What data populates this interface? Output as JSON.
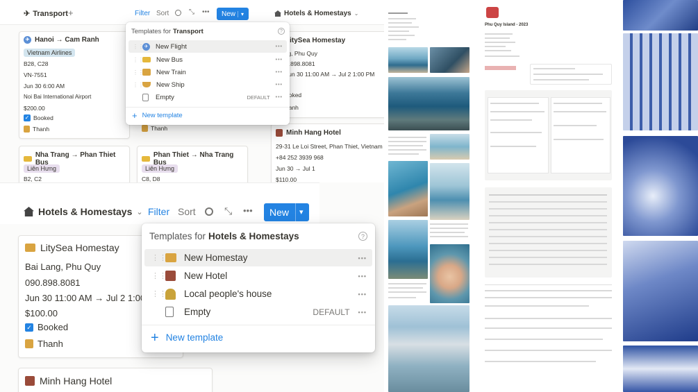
{
  "transport": {
    "tab": "Transport",
    "add": "+",
    "filter": "Filter",
    "sort": "Sort",
    "new": "New",
    "dropdown": "⌄",
    "cards": [
      {
        "title": "Hanoi → Cam Ranh",
        "airline": "Vietnam Airlines",
        "seats": "B28, C28",
        "code": "VN-7551",
        "time": "Jun 30 6:00 AM",
        "place": "Noi Bai International Airport",
        "price": "$200.00",
        "booked": "Booked",
        "person": "Thanh"
      },
      {
        "title": "Nha Trang → Phan Thiet Bus",
        "airline": "Liên Hưng",
        "seats": "B2, C2"
      },
      {
        "title": "Phan Thiet → Nha Trang Bus",
        "airline": "Liên Hưng",
        "seats": "C8, D8"
      }
    ],
    "partial": {
      "title": "LitySea Homestay",
      "addr": "ang, Phu Quy",
      "phone": "0.898.8081",
      "time": "Jun 30 11:00 AM → Jul 2 1:00 PM",
      "booked": "ooked",
      "person": "hanh",
      "person2": "Thanh"
    },
    "minh": {
      "title": "Minh Hang Hotel",
      "addr": "29-31 Le Loi Street, Phan Thiet, Vietnam",
      "phone": "+84 252 3939 968",
      "time": "Jun 30 → Jul 1",
      "price": "$110.00"
    },
    "hotels_tab": "Hotels & Homestays",
    "menu": {
      "title_prefix": "Templates for",
      "title_db": "Transport",
      "items": [
        {
          "label": "New Flight",
          "icon": "airplane-icon"
        },
        {
          "label": "New Bus",
          "icon": "bus-icon"
        },
        {
          "label": "New Train",
          "icon": "train-icon"
        },
        {
          "label": "New Ship",
          "icon": "ship-icon"
        },
        {
          "label": "Empty",
          "icon": "page-icon",
          "badge": "DEFAULT"
        }
      ],
      "new_template": "New template",
      "more": "•••"
    }
  },
  "hotels": {
    "tab": "Hotels & Homestays",
    "filter": "Filter",
    "sort": "Sort",
    "new": "New",
    "card": {
      "title": "LitySea Homestay",
      "addr": "Bai Lang, Phu Quy",
      "phone": "090.898.8081",
      "time": "Jun 30 11:00 AM → Jul 2 1:00 PM",
      "price": "$100.00",
      "booked": "Booked",
      "person": "Thanh"
    },
    "card2": {
      "title": "Minh Hang Hotel"
    },
    "menu": {
      "title_prefix": "Templates for",
      "title_db": "Hotels & Homestays",
      "items": [
        {
          "label": "New Homestay",
          "icon": "house-icon"
        },
        {
          "label": "New Hotel",
          "icon": "hotel-icon"
        },
        {
          "label": "Local people's house",
          "icon": "person-icon"
        },
        {
          "label": "Empty",
          "icon": "page-icon",
          "badge": "DEFAULT"
        }
      ],
      "new_template": "New template",
      "more": "•••"
    }
  },
  "doc": {
    "title": "Phu Quy Island - 2023"
  },
  "colors": {
    "accent": "#2383e2",
    "tag_blue": "#d3e5ef",
    "tag_purple": "#e8deee",
    "blue_photo": "#3d5eaa"
  }
}
